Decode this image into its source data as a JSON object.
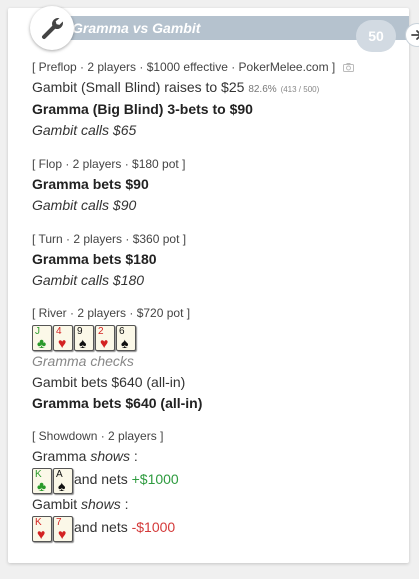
{
  "header": {
    "title": "Gramma vs Gambit",
    "hand_count": "50",
    "wrench_icon": "wrench-icon",
    "next_icon": "arrow-right-icon"
  },
  "preflop": {
    "heading_start": "[ Preflop · 2 players · $1000 effective · PokerMelee.com ]",
    "camera_icon": "camera-icon",
    "action1_text": "Gambit (Small Blind) raises to $25",
    "action1_pct": "82.6%",
    "action1_ratio": "(413 / 500)",
    "action2": "Gramma (Big Blind) 3-bets to $90",
    "action3": "Gambit calls $65"
  },
  "flop": {
    "heading": "[ Flop · 2 players · $180 pot ]",
    "action1": "Gramma bets $90",
    "action2": "Gambit calls $90"
  },
  "turn": {
    "heading": "[ Turn · 2 players · $360 pot ]",
    "action1": "Gramma bets $180",
    "action2": "Gambit calls $180"
  },
  "river": {
    "heading": "[ River · 2 players · $720 pot ]",
    "board": [
      {
        "rank": "J",
        "suit": "♣",
        "color": "#2a9a2a"
      },
      {
        "rank": "4",
        "suit": "♥",
        "color": "#d32222"
      },
      {
        "rank": "9",
        "suit": "♠",
        "color": "#111111"
      },
      {
        "rank": "2",
        "suit": "♥",
        "color": "#d32222"
      },
      {
        "rank": "6",
        "suit": "♠",
        "color": "#111111"
      }
    ],
    "action1": "Gramma checks",
    "action2": "Gambit bets $640 (all-in)",
    "action3": "Gramma bets $640 (all-in)"
  },
  "showdown": {
    "heading": "[ Showdown · 2 players ]",
    "player1_name": "Gramma",
    "player1_shows": "shows",
    "player1_cards": [
      {
        "rank": "K",
        "suit": "♣",
        "color": "#2a9a2a"
      },
      {
        "rank": "A",
        "suit": "♠",
        "color": "#111111"
      }
    ],
    "player1_nets_label": "and nets",
    "player1_result": "+$1000",
    "player2_name": "Gambit",
    "player2_shows": "shows",
    "player2_cards": [
      {
        "rank": "K",
        "suit": "♥",
        "color": "#d32222"
      },
      {
        "rank": "7",
        "suit": "♥",
        "color": "#d32222"
      }
    ],
    "player2_nets_label": "and nets",
    "player2_result": "-$1000",
    "colon": ":"
  }
}
